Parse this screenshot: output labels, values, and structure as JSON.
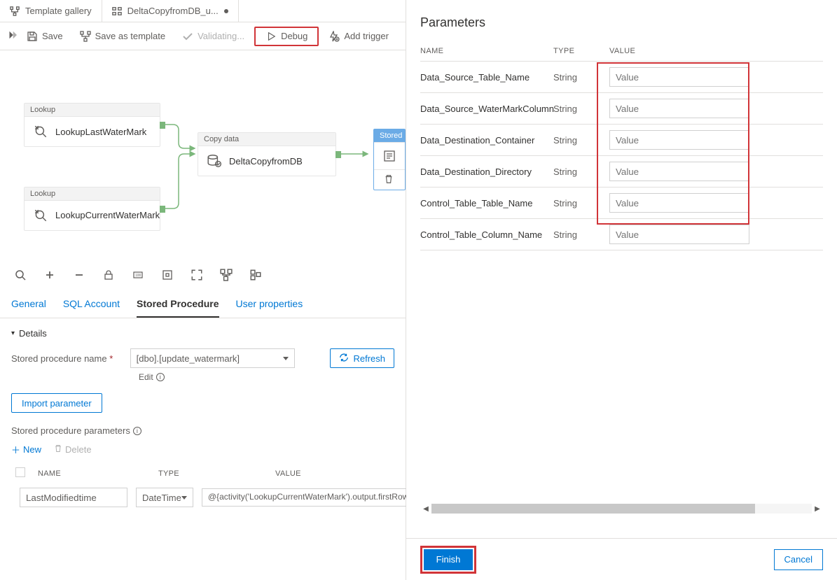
{
  "tabs": {
    "templateGallery": "Template gallery",
    "pipelineName": "DeltaCopyfromDB_u..."
  },
  "toolbar": {
    "save": "Save",
    "saveAsTemplate": "Save as template",
    "validating": "Validating...",
    "debug": "Debug",
    "addTrigger": "Add trigger"
  },
  "activities": {
    "lookupType": "Lookup",
    "copyType": "Copy data",
    "storedType": "Stored",
    "lookupLast": "LookupLastWaterMark",
    "lookupCurrent": "LookupCurrentWaterMark",
    "copy": "DeltaCopyfromDB"
  },
  "detailTabs": {
    "general": "General",
    "sqlAccount": "SQL Account",
    "storedProcedure": "Stored Procedure",
    "userProperties": "User properties"
  },
  "details": {
    "sectionTitle": "Details",
    "spNameLabel": "Stored procedure name",
    "spNameValue": "[dbo].[update_watermark]",
    "edit": "Edit",
    "refresh": "Refresh",
    "importParameter": "Import parameter",
    "spParamsLabel": "Stored procedure parameters",
    "new": "New",
    "delete": "Delete",
    "grid": {
      "header": {
        "name": "NAME",
        "type": "TYPE",
        "value": "VALUE"
      },
      "row": {
        "name": "LastModifiedtime",
        "type": "DateTime",
        "value": "@{activity('LookupCurrentWaterMark').output.firstRow.NewWatermarkValue}"
      }
    }
  },
  "panel": {
    "title": "Parameters",
    "header": {
      "name": "NAME",
      "type": "TYPE",
      "value": "VALUE"
    },
    "placeholder": "Value",
    "rows": [
      {
        "name": "Data_Source_Table_Name",
        "type": "String"
      },
      {
        "name": "Data_Source_WaterMarkColumn",
        "type": "String"
      },
      {
        "name": "Data_Destination_Container",
        "type": "String"
      },
      {
        "name": "Data_Destination_Directory",
        "type": "String"
      },
      {
        "name": "Control_Table_Table_Name",
        "type": "String"
      },
      {
        "name": "Control_Table_Column_Name",
        "type": "String"
      }
    ],
    "finish": "Finish",
    "cancel": "Cancel"
  }
}
